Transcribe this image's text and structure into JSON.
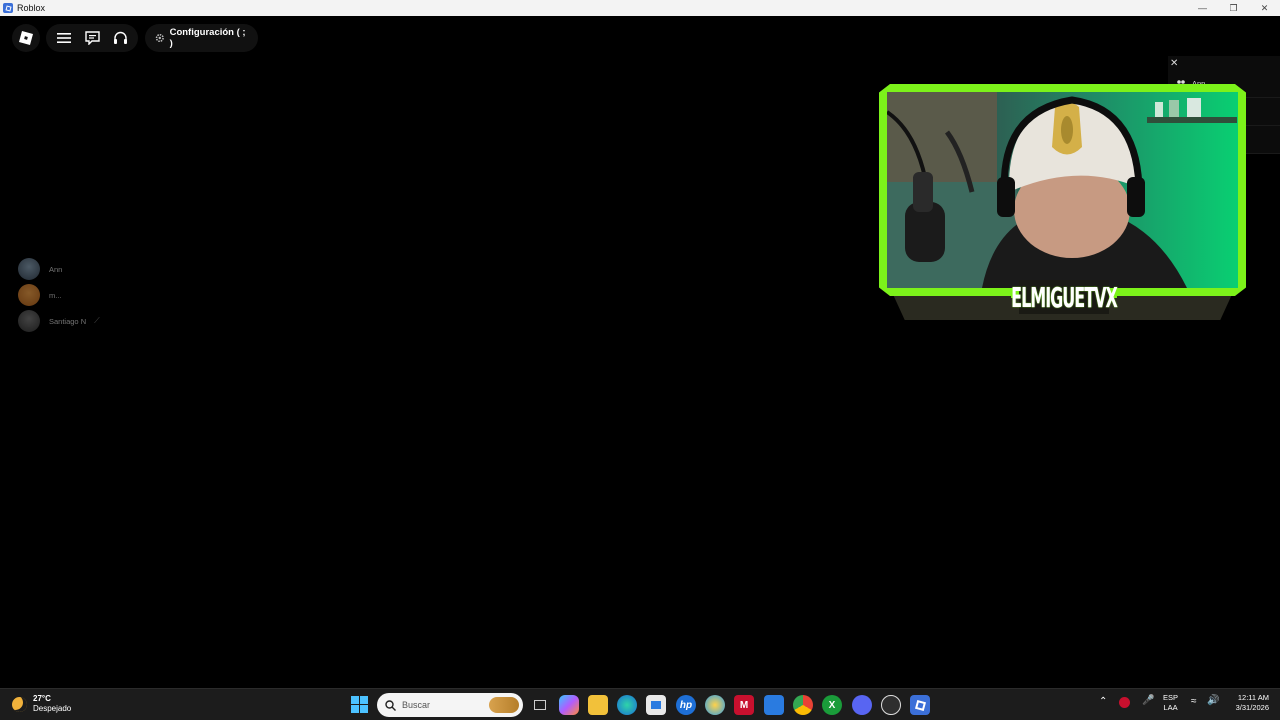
{
  "window": {
    "title": "Roblox"
  },
  "topbar": {
    "config_label": "Configuración ( ; )"
  },
  "players": [
    {
      "name": "Ann"
    },
    {
      "name": "m..."
    },
    {
      "name": "Santiago N"
    }
  ],
  "panel": {
    "first_name": "Ann"
  },
  "overlay": {
    "streamer_name": "ELMIGUETVX"
  },
  "taskbar": {
    "temperature": "27°C",
    "condition": "Despejado",
    "search_placeholder": "Buscar",
    "lang_top": "ESP",
    "lang_bottom": "LAA",
    "time": "12:11 AM",
    "date": "3/31/2026"
  },
  "colors": {
    "overlay_green": "#7cf21a",
    "taskbar_bg": "#1c1c1c"
  },
  "icons": [
    "roblox-logo-icon",
    "menu-icon",
    "chat-icon",
    "headset-icon",
    "gear-icon",
    "close-icon",
    "people-icon",
    "microphone-off-icon",
    "moon-icon",
    "windows-start-icon",
    "search-icon"
  ]
}
